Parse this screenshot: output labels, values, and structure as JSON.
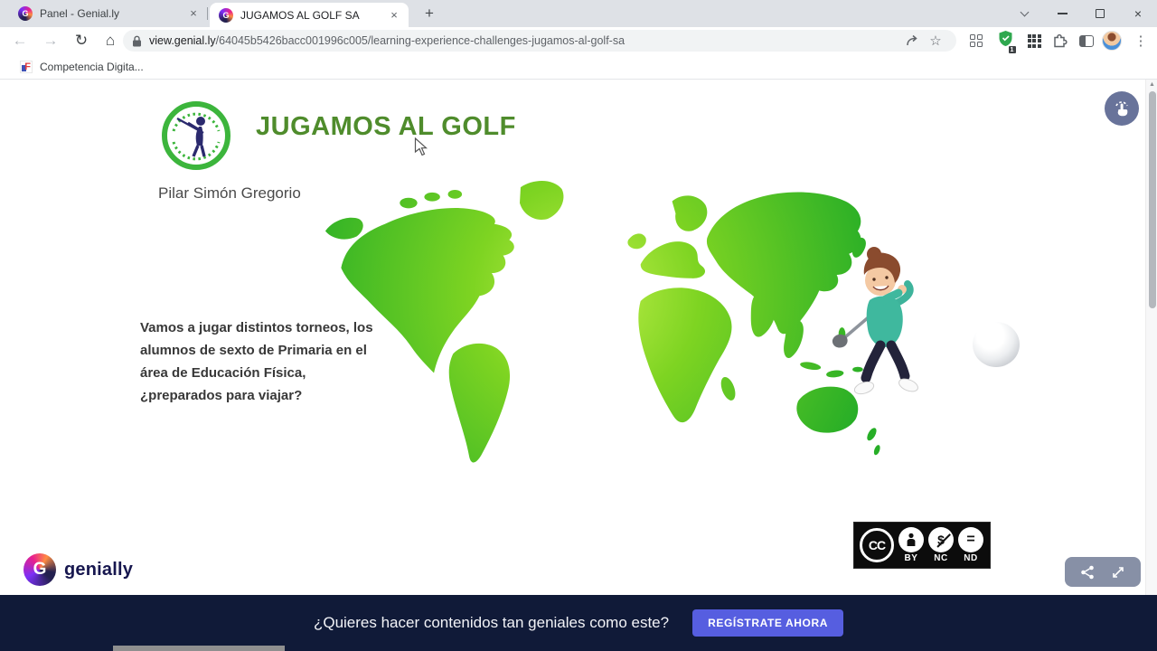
{
  "browser": {
    "tabs": [
      {
        "title": "Panel - Genial.ly",
        "favicon_letter": "G",
        "close_glyph": "×"
      },
      {
        "title": "JUGAMOS AL GOLF SA",
        "favicon_letter": "G",
        "close_glyph": "×"
      }
    ],
    "new_tab_glyph": "+",
    "window_controls": {
      "close_glyph": "×"
    },
    "toolbar": {
      "back_glyph": "←",
      "forward_glyph": "→",
      "reload_glyph": "↻",
      "home_glyph": "⌂",
      "star_glyph": "☆",
      "menu_glyph": "⋮",
      "url_domain": "view.genial.ly",
      "url_path": "/64045b5426bacc001996c005/learning-experience-challenges-jugamos-al-golf-sa",
      "extension_badge": "1"
    },
    "bookmarks_bar": {
      "items": [
        {
          "label": "Competencia Digita...",
          "favicon_letter": "F"
        }
      ]
    },
    "scrollbar_arrow_glyph": "▲"
  },
  "page": {
    "title": "JUGAMOS AL GOLF",
    "author": "Pilar Simón Gregorio",
    "paragraph": [
      "Vamos a jugar distintos torneos, los",
      "alumnos de sexto de Primaria en el",
      "área de Educación Física,",
      "¿preparados para viajar?"
    ],
    "license": {
      "cc": "CC",
      "by": "BY",
      "nc": "NC",
      "nd": "ND",
      "nc_glyph": "$",
      "nd_glyph": "="
    },
    "brand": "genially",
    "brand_letter": "G"
  },
  "banner": {
    "question": "¿Quieres hacer contenidos tan geniales como este?",
    "cta": "REGÍSTRATE AHORA"
  },
  "colors": {
    "accent_green": "#4f8c2c",
    "map_green_dark": "#27ae27",
    "map_green_light": "#c2ef4a",
    "banner_navy": "#101a38",
    "cta_purple": "#565ee0"
  }
}
